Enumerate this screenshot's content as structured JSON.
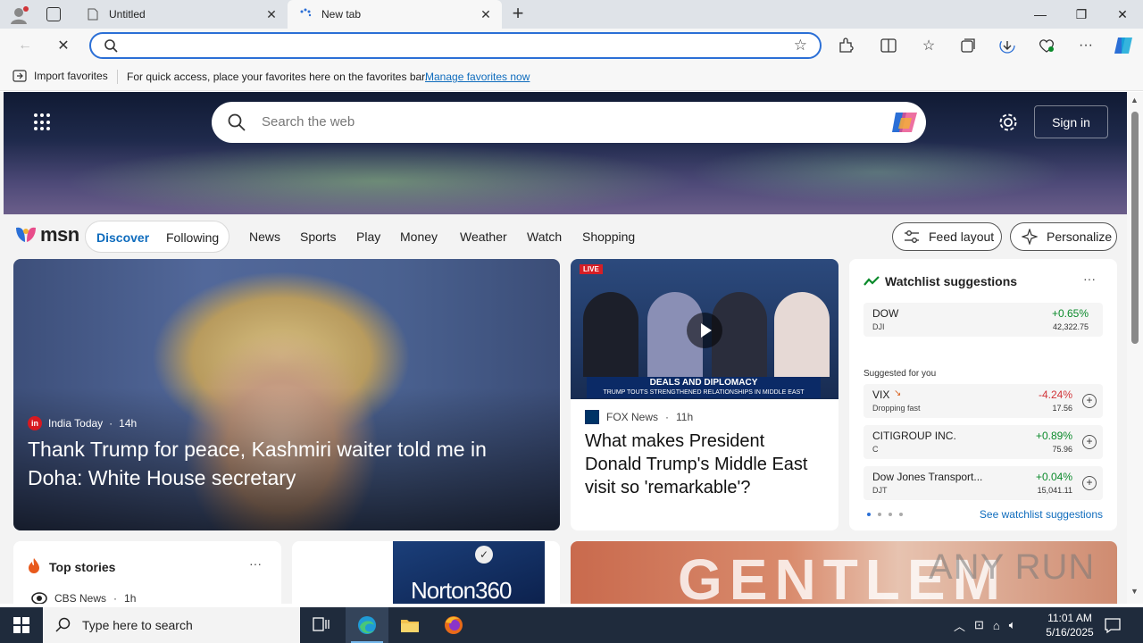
{
  "browser": {
    "tabs": [
      {
        "title": "Untitled",
        "active": false
      },
      {
        "title": "New tab",
        "active": true
      }
    ],
    "address_placeholder": "",
    "favbar": {
      "import_label": "Import favorites",
      "hint": "For quick access, place your favorites here on the favorites bar.",
      "manage_link": "Manage favorites now"
    }
  },
  "hero": {
    "search_placeholder": "Search the web",
    "signin_label": "Sign in"
  },
  "msn": {
    "logo_text": "msn",
    "tabs": {
      "discover": "Discover",
      "following": "Following"
    },
    "nav": [
      "News",
      "Sports",
      "Play",
      "Money",
      "Weather",
      "Watch",
      "Shopping"
    ],
    "feed_layout": "Feed layout",
    "personalize": "Personalize"
  },
  "main_story": {
    "source": "India Today",
    "source_logo": "in",
    "age": "14h",
    "headline": "Thank Trump for peace, Kashmiri waiter told me in Doha: White House secretary"
  },
  "video_story": {
    "live": "LIVE",
    "banner_title": "DEALS AND DIPLOMACY",
    "banner_sub": "TRUMP TOUTS STRENGTHENED RELATIONSHIPS IN MIDDLE EAST",
    "source": "FOX News",
    "age": "11h",
    "headline": "What makes President Donald Trump's Middle East visit so 'remarkable'?"
  },
  "watchlist": {
    "title": "Watchlist suggestions",
    "more": "···",
    "top": {
      "name": "DOW",
      "symbol": "DJI",
      "change": "+0.65%",
      "price": "42,322.75",
      "dir": "up"
    },
    "suggested_label": "Suggested for you",
    "items": [
      {
        "name": "VIX",
        "symbol": "Dropping fast",
        "change": "-4.24%",
        "price": "17.56",
        "dir": "down"
      },
      {
        "name": "CITIGROUP INC.",
        "symbol": "C",
        "change": "+0.89%",
        "price": "75.96",
        "dir": "up"
      },
      {
        "name": "Dow Jones Transport...",
        "symbol": "DJT",
        "change": "+0.04%",
        "price": "15,041.11",
        "dir": "up"
      }
    ],
    "see_all": "See watchlist suggestions"
  },
  "top_stories": {
    "title": "Top stories",
    "more": "···",
    "first_source": "CBS News",
    "first_age": "1h"
  },
  "norton": {
    "label": "Norton360"
  },
  "gentle": {
    "big_text": "GENTLEM"
  },
  "watermark": "ANY RUN",
  "taskbar": {
    "search_placeholder": "Type here to search",
    "time": "11:01 AM",
    "date": "5/16/2025"
  },
  "colors": {
    "accent": "#0f6cbd",
    "up": "#0b8a2b",
    "down": "#d13438",
    "taskbar": "#1f2b3c"
  }
}
